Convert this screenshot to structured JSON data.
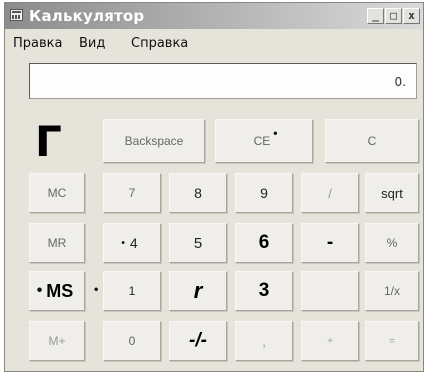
{
  "window": {
    "title": "Калькулятор",
    "controls": {
      "minimize": "_",
      "maximize": "□",
      "close": "x"
    }
  },
  "menu": [
    "Правка",
    "Вид",
    "Справка"
  ],
  "display": {
    "value": "0."
  },
  "memory_indicator": "Г",
  "rows": {
    "top": [
      "Backspace",
      "CE",
      "C"
    ],
    "r1": [
      "MC",
      "7",
      "8",
      "9",
      "/",
      "sqrt"
    ],
    "r2": [
      "MR",
      "4",
      "5",
      "6",
      "-",
      "%"
    ],
    "r3": [
      "MS",
      "1",
      "r",
      "3",
      "",
      "1/x"
    ],
    "r4": [
      "M+",
      "0",
      "-/-",
      ",",
      "+",
      "="
    ]
  }
}
